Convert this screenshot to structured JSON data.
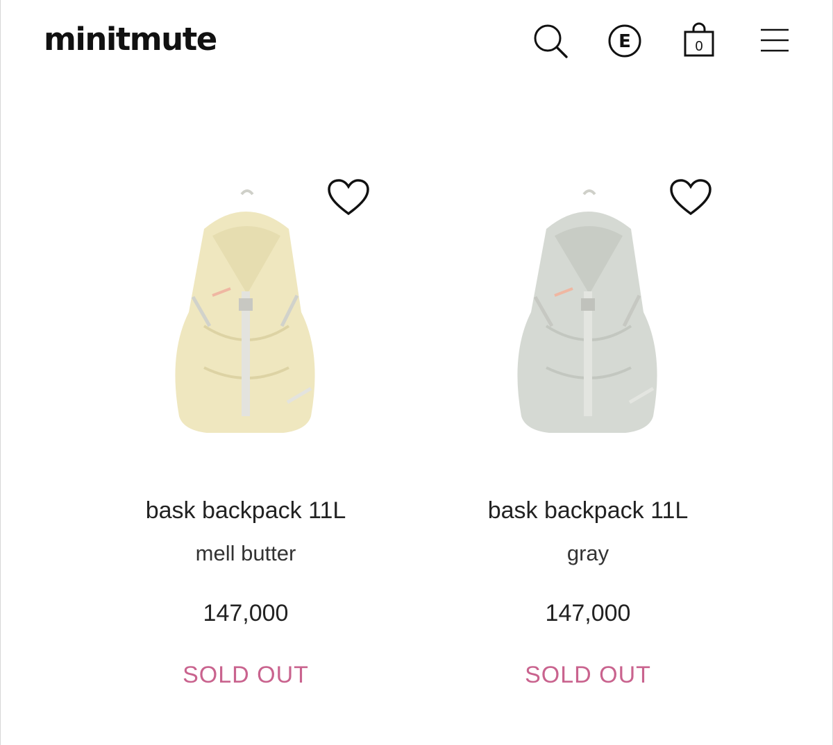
{
  "header": {
    "logo": "minitmute",
    "cart_count": "0",
    "event_icon_letter": "E"
  },
  "icons": {
    "search": "search-icon",
    "event": "event-icon",
    "cart": "shopping-bag-icon",
    "menu": "hamburger-menu-icon",
    "wishlist": "heart-icon"
  },
  "colors": {
    "sold_out": "#c9638e",
    "bag_butter": "#efe7bf",
    "bag_gray": "#d5d9d3"
  },
  "products": [
    {
      "name": "bask backpack 11L",
      "color": "mell butter",
      "price": "147,000",
      "status": "SOLD OUT"
    },
    {
      "name": "bask backpack 11L",
      "color": "gray",
      "price": "147,000",
      "status": "SOLD OUT"
    }
  ]
}
